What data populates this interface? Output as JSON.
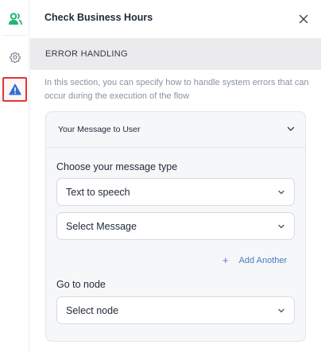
{
  "colors": {
    "accent_green": "#22b573",
    "warning_blue": "#2f6fdb",
    "highlight_red": "#e0363b",
    "link_blue": "#4b78c8"
  },
  "rail": {
    "items": [
      {
        "icon": "users-icon"
      },
      {
        "icon": "gear-icon"
      },
      {
        "icon": "warning-icon",
        "selected": true
      }
    ]
  },
  "header": {
    "title": "Check Business Hours",
    "close_icon": "close-icon"
  },
  "section": {
    "title": "ERROR HANDLING",
    "description": "In this section, you can specify how to handle system errors that can occur during the execution of the flow"
  },
  "card": {
    "title": "Your Message to User",
    "message_type_label": "Choose your message type",
    "message_type_value": "Text to speech",
    "message_select_placeholder": "Select Message",
    "add_another_label": "Add Another",
    "go_to_node_label": "Go to node",
    "node_select_placeholder": "Select node"
  }
}
